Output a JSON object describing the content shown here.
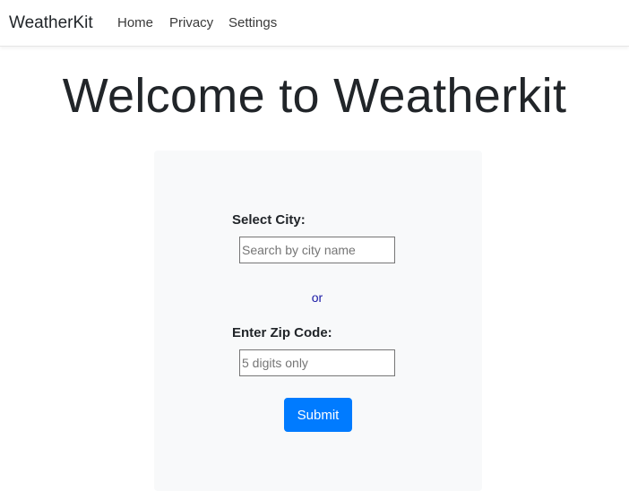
{
  "navbar": {
    "brand": "WeatherKit",
    "links": [
      {
        "label": "Home"
      },
      {
        "label": "Privacy"
      },
      {
        "label": "Settings"
      }
    ]
  },
  "main": {
    "heading": "Welcome to Weatherkit",
    "form": {
      "city_label": "Select City:",
      "city_placeholder": "Search by city name",
      "city_value": "",
      "separator": "or",
      "zip_label": "Enter Zip Code:",
      "zip_placeholder": "5 digits only",
      "zip_value": "",
      "submit_label": "Submit"
    }
  },
  "colors": {
    "accent": "#007bff",
    "panel_bg": "#f8f9fa",
    "separator_text": "#1a1aa6"
  }
}
